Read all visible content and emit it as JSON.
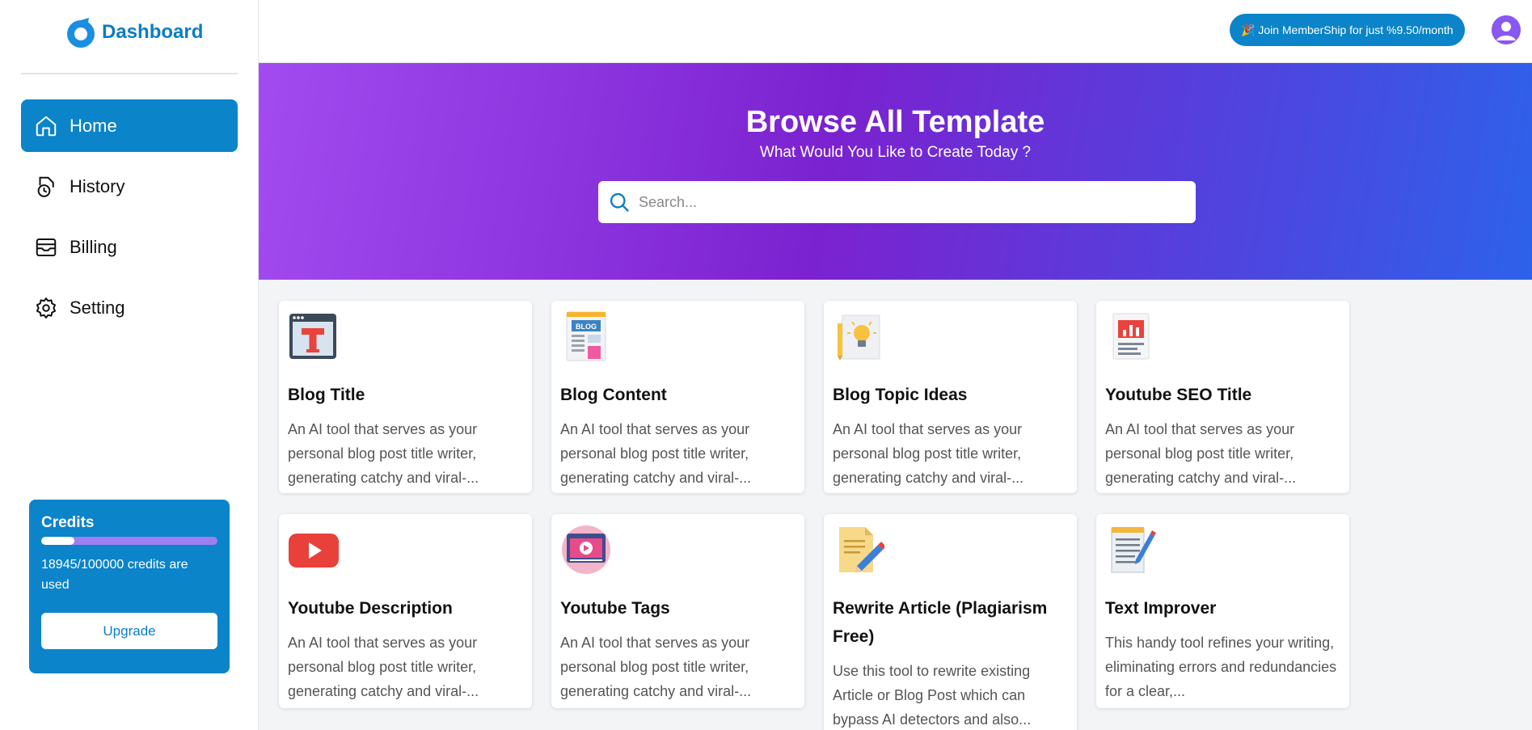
{
  "app": {
    "logo_text": "Dashboard"
  },
  "sidebar": {
    "items": [
      {
        "label": "Home",
        "icon": "home-icon",
        "active": true
      },
      {
        "label": "History",
        "icon": "history-icon"
      },
      {
        "label": "Billing",
        "icon": "billing-icon"
      },
      {
        "label": "Setting",
        "icon": "gear-icon"
      }
    ],
    "credits": {
      "title": "Credits",
      "used": 18945,
      "total": 100000,
      "text": "18945/100000 credits are used",
      "upgrade_label": "Upgrade"
    }
  },
  "header": {
    "membership_label": "🎉 Join MemberShip for just %9.50/month"
  },
  "hero": {
    "title": "Browse All Template",
    "subtitle": "What Would You Like to Create Today ?",
    "search_placeholder": "Search..."
  },
  "templates": [
    {
      "title": "Blog Title",
      "icon": "blog-title-icon",
      "desc": "An AI tool that serves as your personal blog post title writer, generating catchy and viral-..."
    },
    {
      "title": "Blog Content",
      "icon": "blog-content-icon",
      "desc": "An AI tool that serves as your personal blog post title writer, generating catchy and viral-..."
    },
    {
      "title": "Blog Topic Ideas",
      "icon": "lightbulb-icon",
      "desc": "An AI tool that serves as your personal blog post title writer, generating catchy and viral-..."
    },
    {
      "title": "Youtube SEO Title",
      "icon": "seo-report-icon",
      "desc": "An AI tool that serves as your personal blog post title writer, generating catchy and viral-..."
    },
    {
      "title": "Youtube Description",
      "icon": "youtube-icon",
      "desc": "An AI tool that serves as your personal blog post title writer, generating catchy and viral-..."
    },
    {
      "title": "Youtube Tags",
      "icon": "video-player-icon",
      "desc": "An AI tool that serves as your personal blog post title writer, generating catchy and viral-..."
    },
    {
      "title": "Rewrite Article (Plagiarism Free)",
      "icon": "rewrite-pencil-icon",
      "desc": "Use this tool to rewrite existing Article or Blog Post which can bypass AI detectors and also..."
    },
    {
      "title": "Text Improver",
      "icon": "notepad-pencil-icon",
      "desc": "This handy tool refines your writing, eliminating errors and redundancies for a clear,..."
    }
  ]
}
